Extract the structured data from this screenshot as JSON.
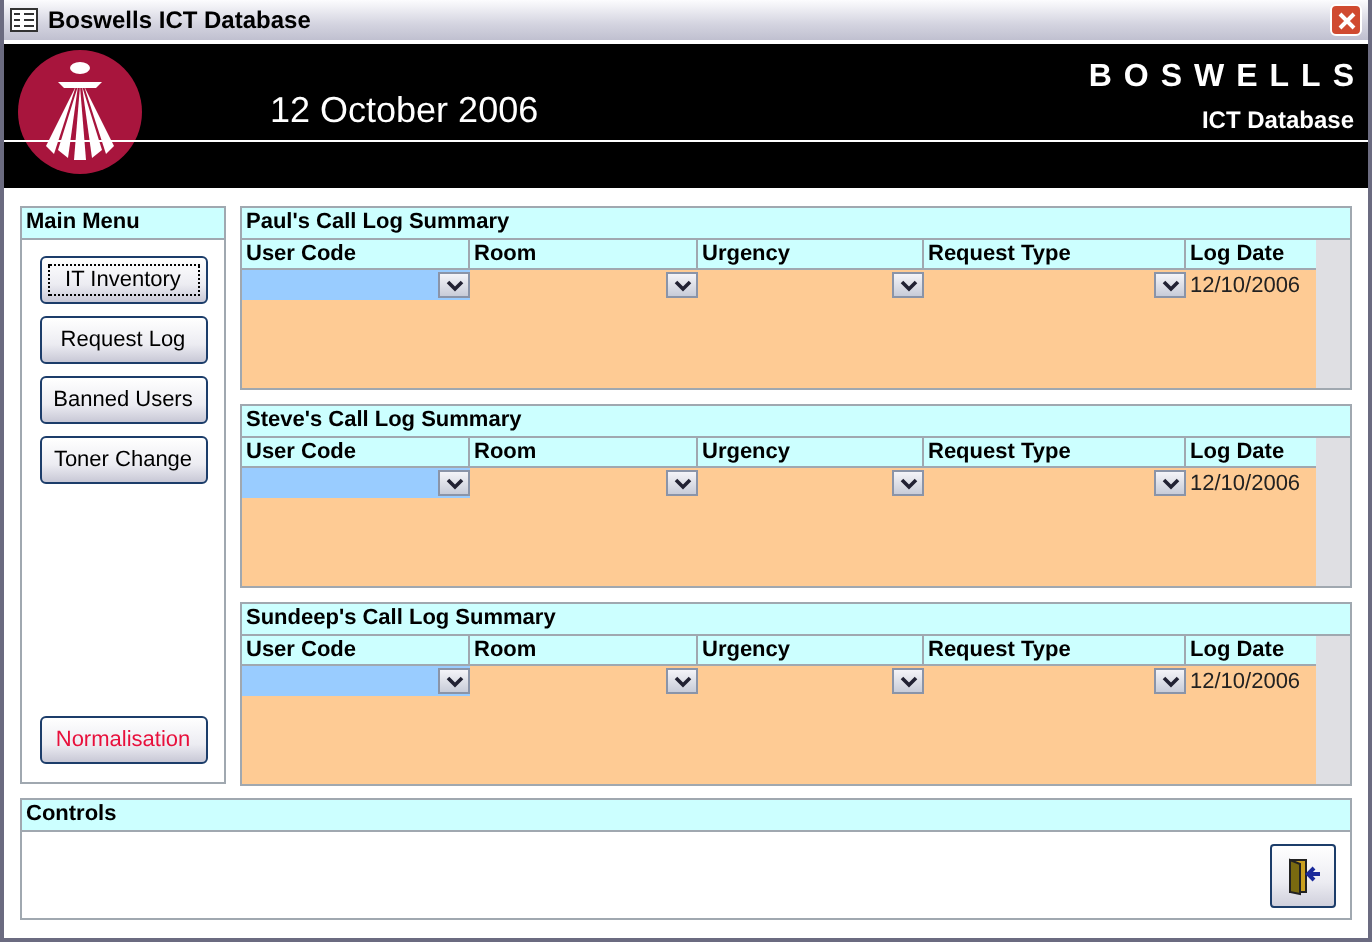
{
  "window": {
    "title": "Boswells ICT Database"
  },
  "header": {
    "date": "12 October 2006",
    "brand": "BOSWELLS",
    "subtitle": "ICT Database"
  },
  "main_menu": {
    "title": "Main Menu",
    "buttons": [
      {
        "label": "IT Inventory",
        "focused": true,
        "kind": "normal"
      },
      {
        "label": "Request Log",
        "focused": false,
        "kind": "normal"
      },
      {
        "label": "Banned Users",
        "focused": false,
        "kind": "normal"
      },
      {
        "label": "Toner Change",
        "focused": false,
        "kind": "normal"
      },
      {
        "label": "Normalisation",
        "focused": false,
        "kind": "warning"
      }
    ]
  },
  "summaries": [
    {
      "title": "Paul's Call Log Summary",
      "columns": [
        "User Code",
        "Room",
        "Urgency",
        "Request Type",
        "Log Date"
      ],
      "log_date": "12/10/2006"
    },
    {
      "title": "Steve's Call Log Summary",
      "columns": [
        "User Code",
        "Room",
        "Urgency",
        "Request Type",
        "Log Date"
      ],
      "log_date": "12/10/2006"
    },
    {
      "title": "Sundeep's Call Log Summary",
      "columns": [
        "User Code",
        "Room",
        "Urgency",
        "Request Type",
        "Log Date"
      ],
      "log_date": "12/10/2006"
    }
  ],
  "controls": {
    "title": "Controls"
  }
}
